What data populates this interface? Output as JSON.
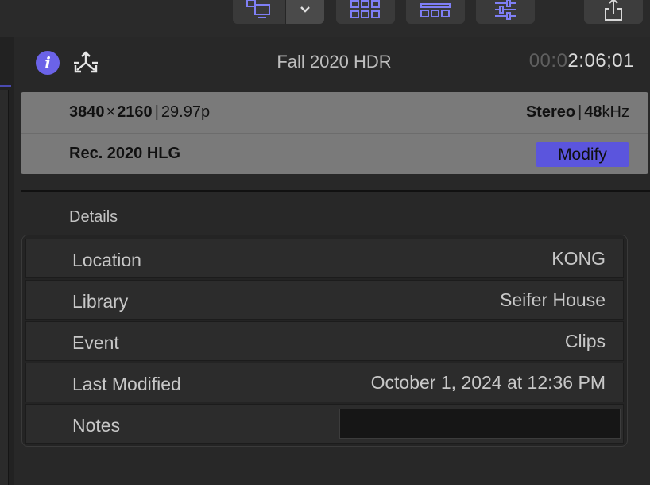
{
  "toolbar": {
    "icons": [
      "monitor-layout-icon",
      "chevron-down-icon",
      "browser-grid-icon",
      "timeline-grid-icon",
      "inspector-sliders-icon",
      "share-icon"
    ]
  },
  "header": {
    "info_icon": "i",
    "clip_title": "Fall 2020 HDR",
    "timecode_dim": "00:0",
    "timecode_bright": "2:06;01"
  },
  "summary": {
    "width": "3840",
    "times": "×",
    "height": "2160",
    "separator": "|",
    "frame_rate": "29.97p",
    "audio_channels": "Stereo",
    "sample_rate_value": "48",
    "sample_rate_unit": "kHz",
    "color_space": "Rec. 2020 HLG",
    "modify_label": "Modify"
  },
  "details": {
    "section_label": "Details",
    "rows": [
      {
        "label": "Location",
        "value": "KONG"
      },
      {
        "label": "Library",
        "value": "Seifer House"
      },
      {
        "label": "Event",
        "value": "Clips"
      },
      {
        "label": "Last Modified",
        "value": "October 1, 2024 at 12:36 PM"
      },
      {
        "label": "Notes",
        "value": ""
      }
    ]
  },
  "colors": {
    "accent": "#6b63e8",
    "modify_button": "#5b55dd",
    "panel_bg": "#282828",
    "summary_bg": "#7a7a7a"
  }
}
